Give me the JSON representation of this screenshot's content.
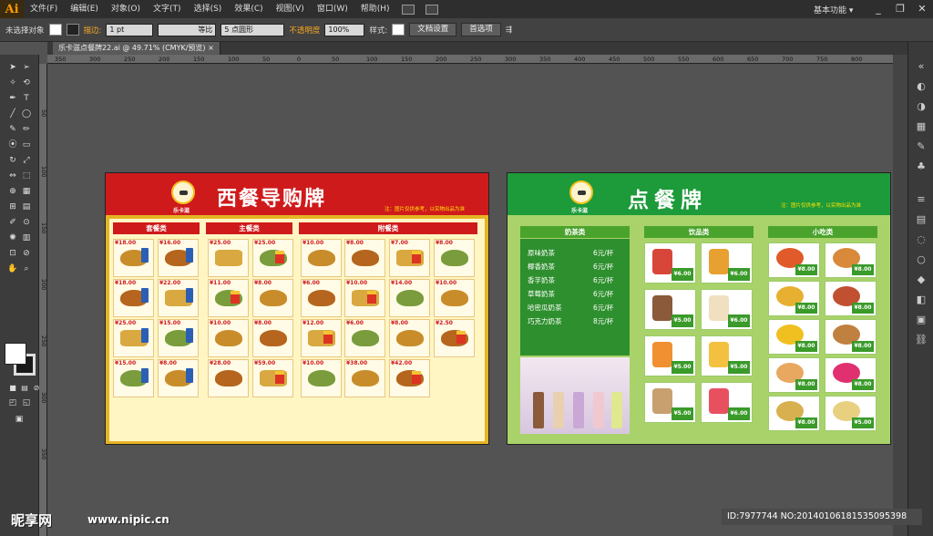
{
  "app": {
    "logo": "Ai",
    "workspace": "基本功能 ▾",
    "win_controls": [
      "_",
      "❐",
      "✕"
    ]
  },
  "menu": [
    "文件(F)",
    "编辑(E)",
    "对象(O)",
    "文字(T)",
    "选择(S)",
    "效果(C)",
    "视图(V)",
    "窗口(W)",
    "帮助(H)"
  ],
  "control": {
    "no_selection": "未选择对象",
    "stroke_label": "描边:",
    "stroke_value": "1 pt",
    "stroke_style": "等比",
    "brush": "5 点圆形",
    "opacity_label": "不透明度",
    "opacity_value": "100%",
    "style_label": "样式:",
    "doc_setup": "文档设置",
    "preferences": "首选项"
  },
  "tab": {
    "title": "乐卡滋点餐牌22.ai @ 49.71% (CMYK/预览)",
    "close": "×"
  },
  "ruler": {
    "top": [
      "350",
      "300",
      "250",
      "200",
      "150",
      "100",
      "50",
      "0",
      "50",
      "100",
      "150",
      "200",
      "250",
      "300",
      "350",
      "400",
      "450",
      "500",
      "550",
      "600",
      "650",
      "700",
      "750",
      "800"
    ],
    "left": [
      "50",
      "100",
      "150",
      "200",
      "250",
      "300",
      "350"
    ]
  },
  "board_a": {
    "title": "西餐导购牌",
    "brand": "乐卡滋",
    "note": "注：图片仅供参考，以实物出品为准",
    "categories": [
      "套餐类",
      "主餐类",
      "附餐类"
    ],
    "prices": [
      "¥18.00",
      "¥16.00",
      "¥25.00",
      "¥25.00",
      "¥10.00",
      "¥8.00",
      "¥7.00",
      "¥8.00",
      "¥18.00",
      "¥22.00",
      "¥11.00",
      "¥8.00",
      "¥6.00",
      "¥10.00",
      "¥14.00",
      "¥10.00",
      "¥25.00",
      "¥15.00",
      "¥10.00",
      "¥8.00",
      "¥12.00",
      "¥6.00",
      "¥8.00",
      "¥2.50",
      "¥15.00",
      "¥8.00",
      "¥28.00",
      "¥59.00",
      "¥10.00",
      "¥38.00",
      "¥42.00"
    ],
    "cell_note": "儿童快乐餐"
  },
  "board_b": {
    "title": "点餐牌",
    "brand": "乐卡滋",
    "note": "注：图片仅供参考，以实物出品为准",
    "categories": [
      "奶茶类",
      "饮品类",
      "小吃类"
    ],
    "teas": [
      {
        "name": "原味奶茶",
        "price": "6元/杯"
      },
      {
        "name": "椰香奶茶",
        "price": "6元/杯"
      },
      {
        "name": "香芋奶茶",
        "price": "6元/杯"
      },
      {
        "name": "草莓奶茶",
        "price": "6元/杯"
      },
      {
        "name": "哈密瓜奶茶",
        "price": "6元/杯"
      },
      {
        "name": "巧克力奶茶",
        "price": "8元/杯"
      }
    ],
    "drink_prices": [
      "¥6.00",
      "¥6.00",
      "¥5.00",
      "¥6.00",
      "¥5.00",
      "¥5.00",
      "¥5.00",
      "¥6.00"
    ],
    "snack_prices": [
      "¥8.00",
      "¥8.00",
      "¥8.00",
      "¥8.00",
      "¥8.00",
      "¥8.00",
      "¥8.00",
      "¥8.00",
      "¥8.00",
      "¥5.00"
    ]
  },
  "watermark": {
    "logo": "昵享网",
    "url": "www.nipic.cn",
    "id": "ID:7977744 NO:20140106181535095398"
  }
}
